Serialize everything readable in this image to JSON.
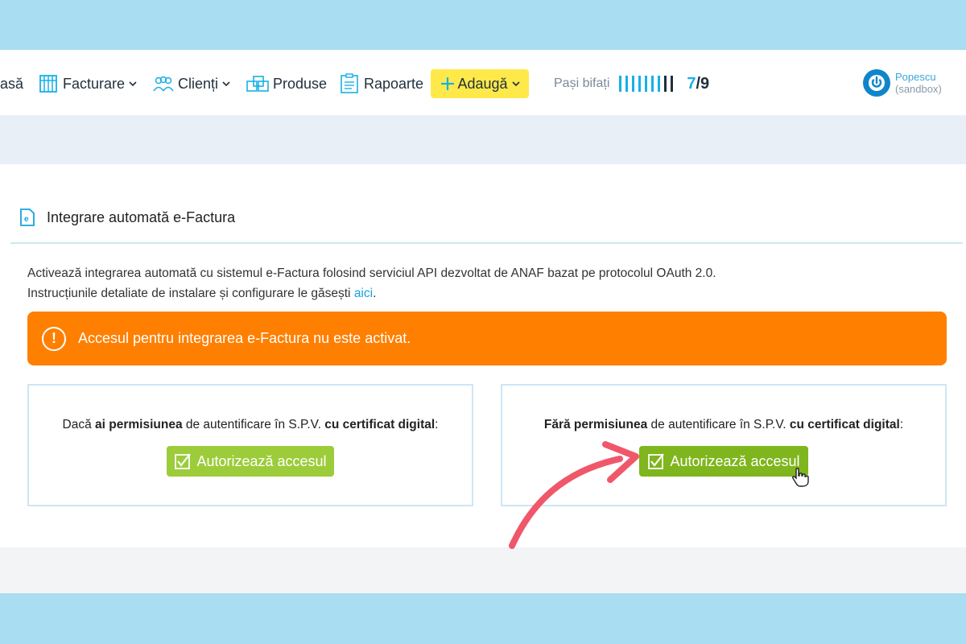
{
  "nav": {
    "items": [
      {
        "label": "asă",
        "icon": "home-icon"
      },
      {
        "label": "Facturare",
        "icon": "invoice-icon"
      },
      {
        "label": "Clienți",
        "icon": "clients-icon"
      },
      {
        "label": "Produse",
        "icon": "products-icon"
      },
      {
        "label": "Rapoarte",
        "icon": "reports-icon"
      }
    ],
    "add_label": "Adaugă",
    "steps_label": "Pași bifați",
    "steps_done": "7",
    "steps_total": "/9",
    "steps_progress": 0.7778,
    "user_name": "Popescu",
    "user_env": "(sandbox)"
  },
  "panel": {
    "title": "Integrare automată e-Factura",
    "intro_line1": "Activează integrarea automată cu sistemul e-Factura folosind serviciul API dezvoltat de ANAF bazat pe protocolul OAuth 2.0.",
    "intro_line2_prefix": "Instrucțiunile detaliate de instalare și configurare le găsești ",
    "intro_link": "aici",
    "intro_line2_suffix": ".",
    "alert_text": "Accesul pentru integrarea e-Factura nu este activat.",
    "cards": [
      {
        "prefix": "Dacă ",
        "bold1": "ai permisiunea",
        "middle": " de autentificare în S.P.V. ",
        "bold2": "cu certificat digital",
        "suffix": ":",
        "button": "Autorizează accesul"
      },
      {
        "prefix": "",
        "bold1": "Fără permisiunea",
        "middle": " de autentificare în S.P.V. ",
        "bold2": "cu certificat digital",
        "suffix": ":",
        "button": "Autorizează accesul"
      }
    ]
  },
  "colors": {
    "accent_blue": "#17b0e6",
    "alert_orange": "#ff7f00",
    "button_green": "#9ccc3a",
    "button_green_hover": "#7fb51d",
    "add_yellow": "#ffe94a",
    "annotation_arrow": "#f0576a"
  }
}
